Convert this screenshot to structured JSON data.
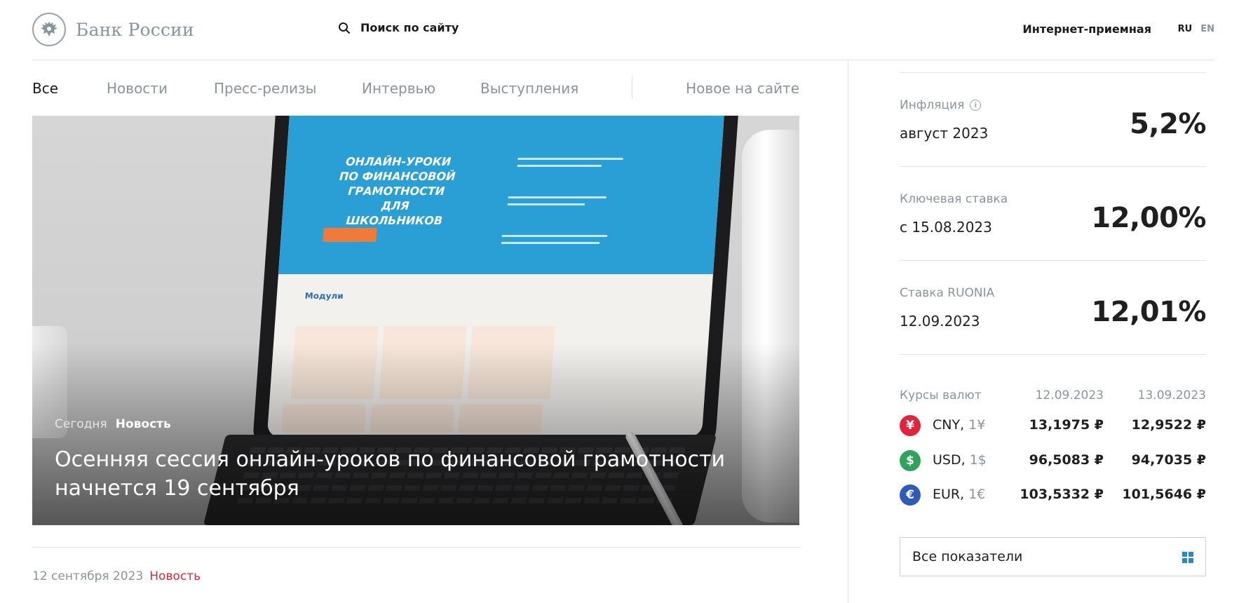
{
  "header": {
    "logo_text": "Банк России",
    "search_label": "Поиск по сайту",
    "reception_link": "Интернет-приемная",
    "languages": {
      "active": "RU",
      "inactive": "EN"
    }
  },
  "tabs": [
    {
      "label": "Все",
      "active": true
    },
    {
      "label": "Новости",
      "active": false
    },
    {
      "label": "Пресс-релизы",
      "active": false
    },
    {
      "label": "Интервью",
      "active": false
    },
    {
      "label": "Выступления",
      "active": false
    },
    {
      "label": "Новое на сайте",
      "active": false
    }
  ],
  "hero": {
    "date": "Сегодня",
    "type": "Новость",
    "title": "Осенняя сессия онлайн-уроков по финансовой грамотности начнется 19 сентября",
    "image_screen_heading": "ОНЛАЙН-УРОКИ ПО ФИНАНСОВОЙ ГРАМОТНОСТИ ДЛЯ ШКОЛЬНИКОВ",
    "image_screen_section": "Модули"
  },
  "news_item": {
    "date": "12 сентября 2023",
    "type": "Новость"
  },
  "indicators": [
    {
      "label": "Инфляция",
      "date": "август 2023",
      "value": "5,2%",
      "has_info": true
    },
    {
      "label": "Ключевая ставка",
      "date": "с 15.08.2023",
      "value": "12,00%",
      "has_info": false
    },
    {
      "label": "Ставка RUONIA",
      "date": "12.09.2023",
      "value": "12,01%",
      "has_info": false
    }
  ],
  "rates": {
    "title": "Курсы валют",
    "date1": "12.09.2023",
    "date2": "13.09.2023",
    "rows": [
      {
        "code": "CNY,",
        "unit": "1¥",
        "symbol": "¥",
        "color": "#e0243a",
        "v1": "13,1975 ₽",
        "v2": "12,9522 ₽"
      },
      {
        "code": "USD,",
        "unit": "1$",
        "symbol": "$",
        "color": "#2fa35a",
        "v1": "96,5083 ₽",
        "v2": "94,7035 ₽"
      },
      {
        "code": "EUR,",
        "unit": "1€",
        "symbol": "€",
        "color": "#2d5bb8",
        "v1": "103,5332 ₽",
        "v2": "101,5646 ₽"
      }
    ]
  },
  "all_indicators_button": "Все показатели",
  "colors": {
    "accent_red": "#d22b3d",
    "muted_text": "#8a949e",
    "button_icon": "#2a88c8"
  }
}
